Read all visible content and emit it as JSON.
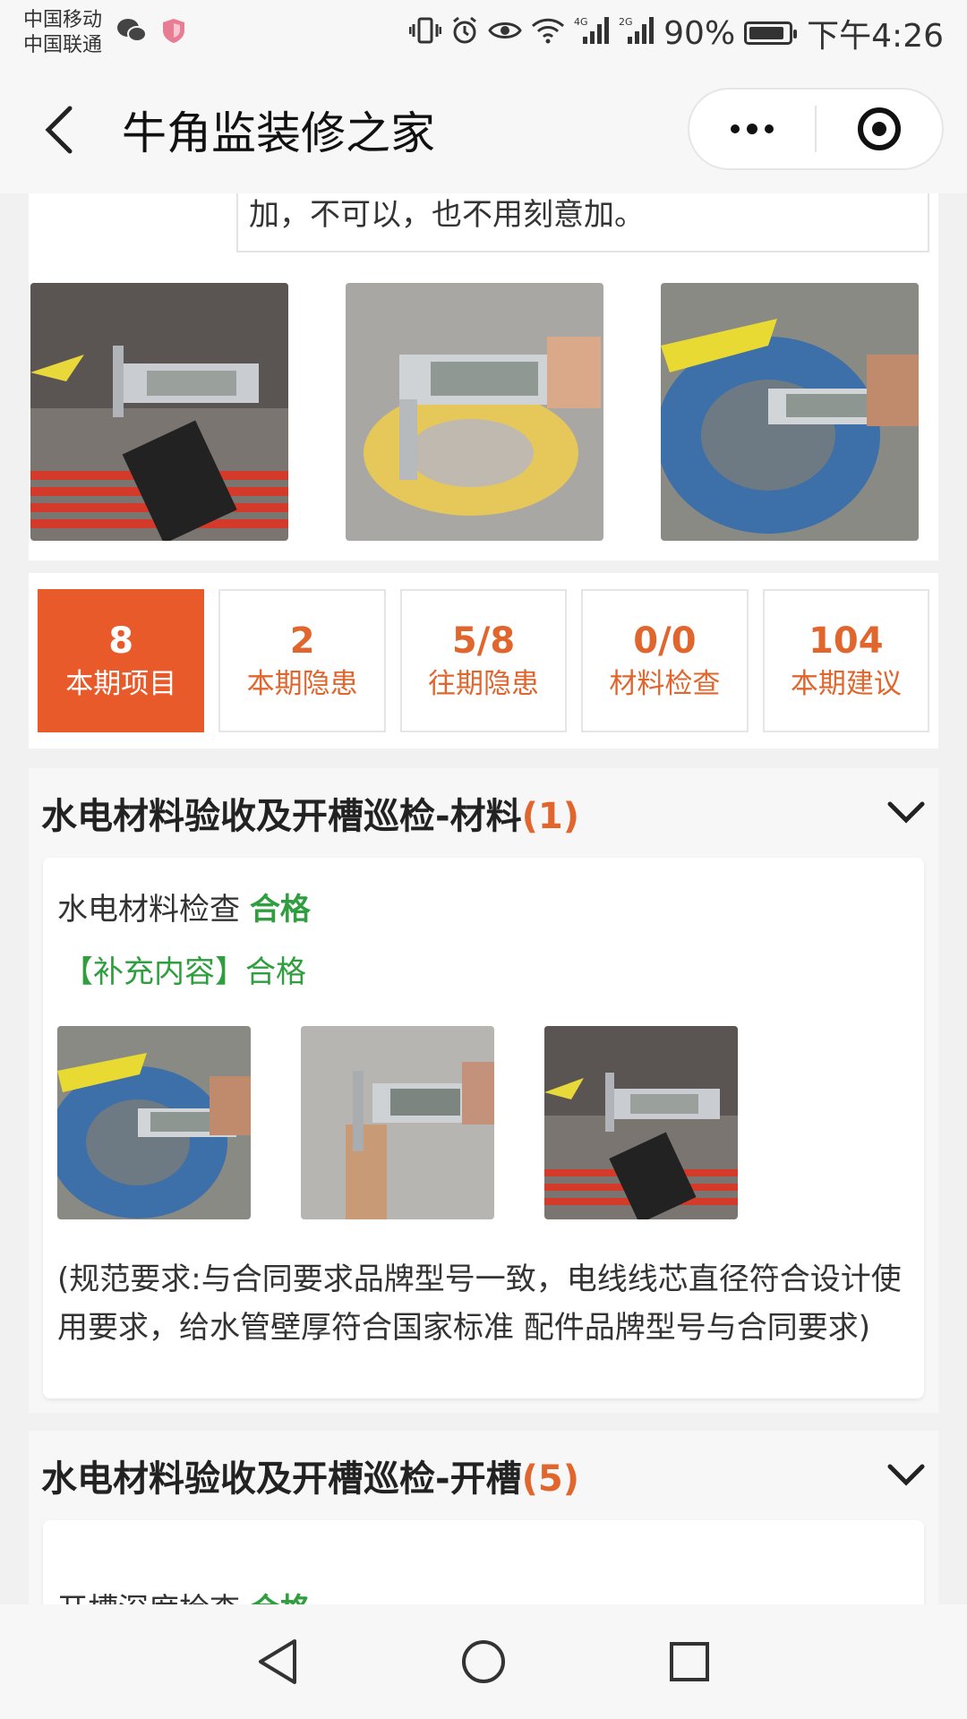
{
  "status_bar": {
    "carrier1": "中国移动",
    "carrier2": "中国联通",
    "network1": "4G",
    "network2": "2G",
    "battery": "90%",
    "battery_level": 0.9,
    "time": "下午4:26"
  },
  "header": {
    "title": "牛角监装修之家",
    "back_icon": "chevron-left-icon",
    "menu_icon": "more-dots-icon",
    "close_icon": "target-circle-icon"
  },
  "note": {
    "text": "加，不可以，也不用刻意加。"
  },
  "stats": [
    {
      "value": "8",
      "label": "本期项目",
      "active": true
    },
    {
      "value": "2",
      "label": "本期隐患",
      "active": false
    },
    {
      "value": "5/8",
      "label": "往期隐患",
      "active": false
    },
    {
      "value": "0/0",
      "label": "材料检查",
      "active": false
    },
    {
      "value": "104",
      "label": "本期建议",
      "active": false
    }
  ],
  "section1": {
    "title": "水电材料验收及开槽巡检-材料",
    "count": "(1)",
    "item_label": "水电材料检查",
    "item_status": "合格",
    "supplement": "【补充内容】合格",
    "requirement": "(规范要求:与合同要求品牌型号一致，电线线芯直径符合设计使用要求，给水管壁厚符合国家标准 配件品牌型号与合同要求)"
  },
  "section2": {
    "title": "水电材料验收及开槽巡检-开槽",
    "count": "(5)",
    "item_label": "开槽深度检查",
    "item_status": "合格"
  },
  "colors": {
    "accent": "#e85a2a",
    "pass_green": "#2e9e3e"
  }
}
